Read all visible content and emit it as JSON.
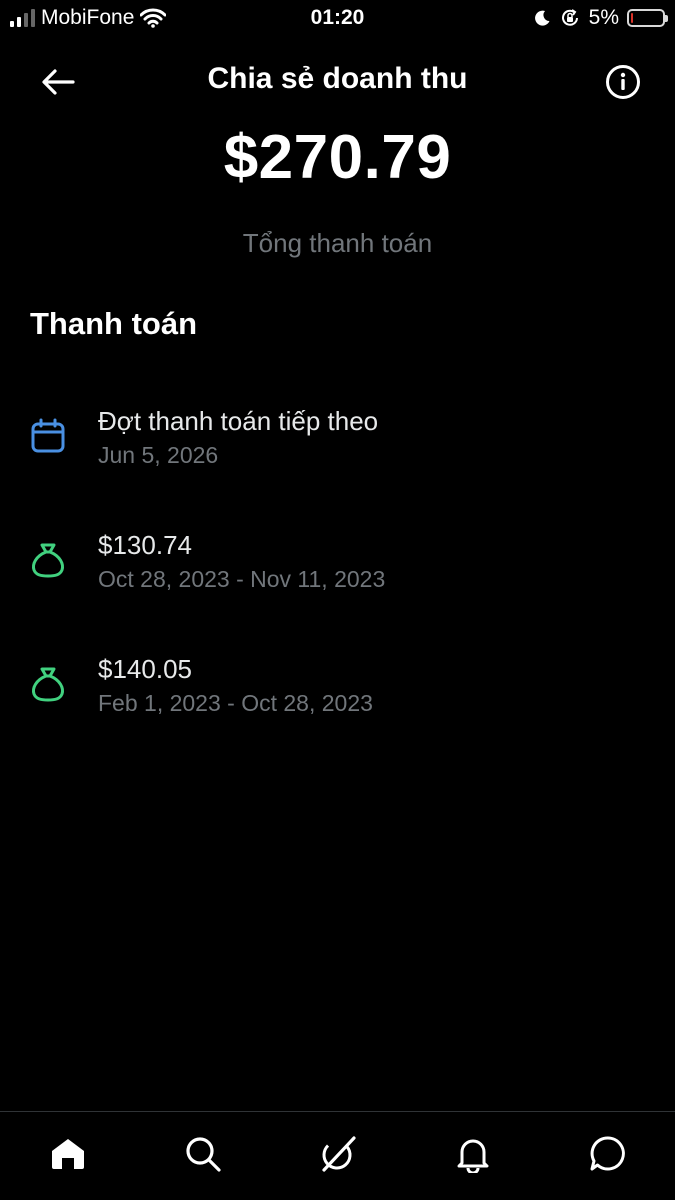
{
  "status_bar": {
    "carrier": "MobiFone",
    "time": "01:20",
    "battery_percent": "5%",
    "battery_level": 0.05,
    "icons": [
      "signal-icon",
      "wifi-icon",
      "moon-icon",
      "rotation-lock-icon",
      "battery-icon"
    ]
  },
  "header": {
    "title": "Chia sẻ doanh thu",
    "back_icon": "back-arrow-icon",
    "info_icon": "info-icon"
  },
  "summary": {
    "total_amount": "$270.79",
    "total_label": "Tổng thanh toán"
  },
  "payments": {
    "section_title": "Thanh toán",
    "items": [
      {
        "icon": "calendar-icon",
        "title": "Đợt thanh toán tiếp theo",
        "subtitle": "Jun 5, 2026"
      },
      {
        "icon": "money-bag-icon",
        "title": "$130.74",
        "subtitle": "Oct 28, 2023 - Nov 11, 2023"
      },
      {
        "icon": "money-bag-icon",
        "title": "$140.05",
        "subtitle": "Feb 1, 2023 - Oct 28, 2023"
      }
    ]
  },
  "bottom_nav": {
    "items": [
      "home-icon",
      "search-icon",
      "grok-icon",
      "notifications-icon",
      "messages-icon"
    ],
    "active": "home-icon"
  },
  "colors": {
    "background": "#000000",
    "text_primary": "#e7e9ea",
    "text_secondary": "#71767b",
    "calendar_icon": "#4a90e2",
    "money_icon": "#41d17f",
    "battery_low": "#ff3b30"
  }
}
